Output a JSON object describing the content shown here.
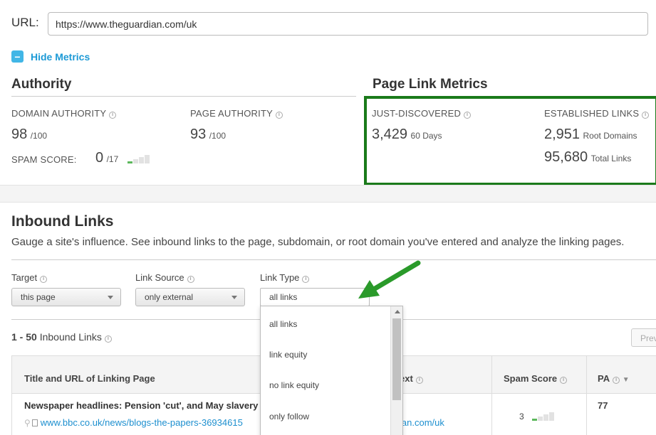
{
  "url": {
    "label": "URL:",
    "value": "https://www.theguardian.com/uk"
  },
  "toggle": {
    "icon": "minus-icon",
    "label": "Hide Metrics"
  },
  "authority": {
    "title": "Authority",
    "domain_authority": {
      "label": "DOMAIN AUTHORITY",
      "value": "98",
      "unit": "/100"
    },
    "page_authority": {
      "label": "PAGE AUTHORITY",
      "value": "93",
      "unit": "/100"
    },
    "spam_score": {
      "label": "SPAM SCORE:",
      "value": "0",
      "unit": "/17"
    }
  },
  "page_link_metrics": {
    "title": "Page Link Metrics",
    "just_discovered": {
      "label": "JUST-DISCOVERED",
      "value": "3,429",
      "unit": "60 Days"
    },
    "established": {
      "label": "ESTABLISHED LINKS",
      "root_domains": {
        "value": "2,951",
        "unit": "Root Domains"
      },
      "total_links": {
        "value": "95,680",
        "unit": "Total Links"
      }
    },
    "highlight_color": "#1a7a1a"
  },
  "inbound": {
    "title": "Inbound Links",
    "description": "Gauge a site's influence. See inbound links to the page, subdomain, or root domain you've entered and analyze the linking pages.",
    "filters": {
      "target": {
        "label": "Target",
        "value": "this page"
      },
      "link_source": {
        "label": "Link Source",
        "value": "only external"
      },
      "link_type": {
        "label": "Link Type",
        "value": "all links"
      }
    },
    "count_range": "1 - 50",
    "count_label": "Inbound Links",
    "prev_label": "Prev",
    "columns": {
      "title_url": "Title and URL of Linking Page",
      "anchor_text": "ext",
      "spam_score": "Spam Score",
      "pa": "PA"
    },
    "rows": [
      {
        "title": "Newspaper headlines: Pension 'cut', and May slavery",
        "url": "www.bbc.co.uk/news/blogs-the-papers-36934615",
        "target_url": "ian.com/uk",
        "spam_score": "3",
        "pa": "77"
      }
    ]
  },
  "dropdown": {
    "options": [
      "all links",
      "link equity",
      "no link equity",
      "only follow"
    ]
  },
  "accent_color": "#1d9ad6"
}
